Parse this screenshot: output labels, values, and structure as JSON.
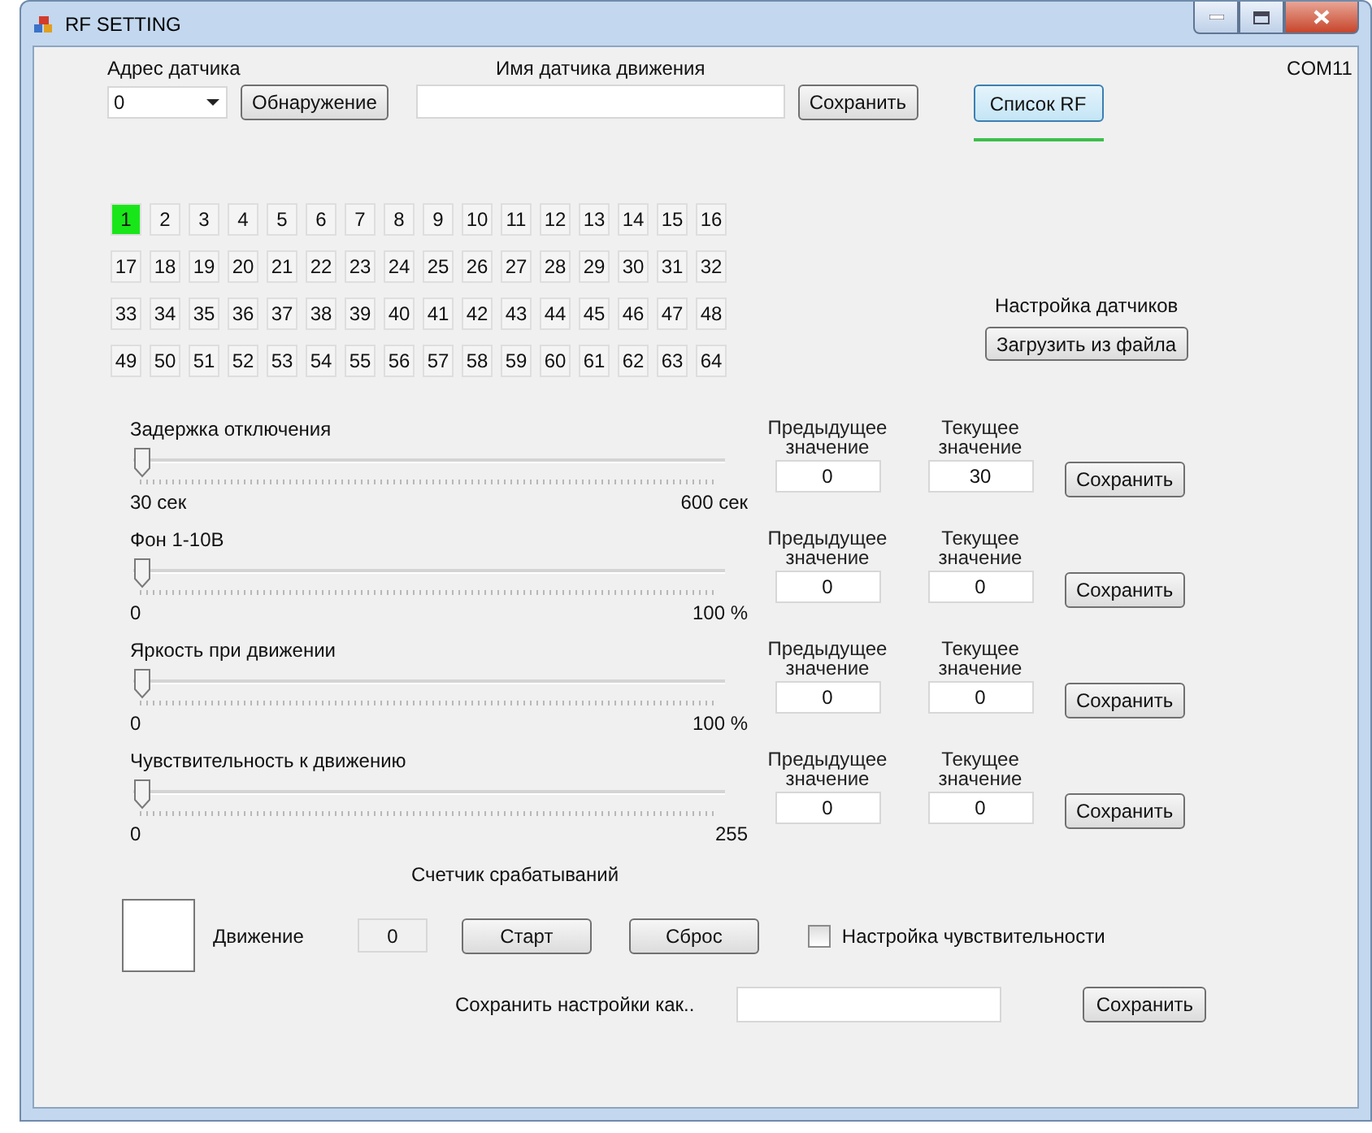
{
  "window": {
    "title": "RF SETTING"
  },
  "address": {
    "label": "Адрес датчика",
    "value": "0"
  },
  "detect_button": "Обнаружение",
  "sensor_name": {
    "label": "Имя датчика движения"
  },
  "save_name_button": "Сохранить",
  "rf_list_button": "Список RF",
  "rf_progress": {
    "level": 1
  },
  "port": "COM11",
  "sensors": [
    {
      "label": "1",
      "selected": true
    },
    {
      "label": "2",
      "selected": false
    },
    {
      "label": "3",
      "selected": false
    },
    {
      "label": "4",
      "selected": false
    },
    {
      "label": "5",
      "selected": false
    },
    {
      "label": "6",
      "selected": false
    },
    {
      "label": "7",
      "selected": false
    },
    {
      "label": "8",
      "selected": false
    },
    {
      "label": "9",
      "selected": false
    },
    {
      "label": "10",
      "selected": false
    },
    {
      "label": "11",
      "selected": false
    },
    {
      "label": "12",
      "selected": false
    },
    {
      "label": "13",
      "selected": false
    },
    {
      "label": "14",
      "selected": false
    },
    {
      "label": "15",
      "selected": false
    },
    {
      "label": "16",
      "selected": false
    },
    {
      "label": "17",
      "selected": false
    },
    {
      "label": "18",
      "selected": false
    },
    {
      "label": "19",
      "selected": false
    },
    {
      "label": "20",
      "selected": false
    },
    {
      "label": "21",
      "selected": false
    },
    {
      "label": "22",
      "selected": false
    },
    {
      "label": "23",
      "selected": false
    },
    {
      "label": "24",
      "selected": false
    },
    {
      "label": "25",
      "selected": false
    },
    {
      "label": "26",
      "selected": false
    },
    {
      "label": "27",
      "selected": false
    },
    {
      "label": "28",
      "selected": false
    },
    {
      "label": "29",
      "selected": false
    },
    {
      "label": "30",
      "selected": false
    },
    {
      "label": "31",
      "selected": false
    },
    {
      "label": "32",
      "selected": false
    },
    {
      "label": "33",
      "selected": false
    },
    {
      "label": "34",
      "selected": false
    },
    {
      "label": "35",
      "selected": false
    },
    {
      "label": "36",
      "selected": false
    },
    {
      "label": "37",
      "selected": false
    },
    {
      "label": "38",
      "selected": false
    },
    {
      "label": "39",
      "selected": false
    },
    {
      "label": "40",
      "selected": false
    },
    {
      "label": "41",
      "selected": false
    },
    {
      "label": "42",
      "selected": false
    },
    {
      "label": "43",
      "selected": false
    },
    {
      "label": "44",
      "selected": false
    },
    {
      "label": "45",
      "selected": false
    },
    {
      "label": "46",
      "selected": false
    },
    {
      "label": "47",
      "selected": false
    },
    {
      "label": "48",
      "selected": false
    },
    {
      "label": "49",
      "selected": false
    },
    {
      "label": "50",
      "selected": false
    },
    {
      "label": "51",
      "selected": false
    },
    {
      "label": "52",
      "selected": false
    },
    {
      "label": "53",
      "selected": false
    },
    {
      "label": "54",
      "selected": false
    },
    {
      "label": "55",
      "selected": false
    },
    {
      "label": "56",
      "selected": false
    },
    {
      "label": "57",
      "selected": false
    },
    {
      "label": "58",
      "selected": false
    },
    {
      "label": "59",
      "selected": false
    },
    {
      "label": "60",
      "selected": false
    },
    {
      "label": "61",
      "selected": false
    },
    {
      "label": "62",
      "selected": false
    },
    {
      "label": "63",
      "selected": false
    },
    {
      "label": "64",
      "selected": false
    }
  ],
  "sensor_settings": {
    "label": "Настройка датчиков",
    "button": "Загрузить из файла"
  },
  "parameters": [
    {
      "label": "Задержка отключения",
      "level": 0,
      "min": "30 сек",
      "max": "600 сек",
      "previous_label": "Предыдущее значение",
      "previous": "0",
      "current_label": "Текущее значение",
      "current": "30",
      "button": "Сохранить"
    },
    {
      "label": "Фон 1-10В",
      "level": 0,
      "min": "0",
      "max": "100 %",
      "previous_label": "Предыдущее значение",
      "previous": "0",
      "current_label": "Текущее значение",
      "current": "0",
      "button": "Сохранить"
    },
    {
      "label": "Яркость при движении",
      "level": 0,
      "min": "0",
      "max": "100 %",
      "previous_label": "Предыдущее значение",
      "previous": "0",
      "current_label": "Текущее значение",
      "current": "0",
      "button": "Сохранить"
    },
    {
      "label": "Чувствительность к движению",
      "level": 0,
      "min": "0",
      "max": "255",
      "previous_label": "Предыдущее значение",
      "previous": "0",
      "current_label": "Текущее значение",
      "current": "0",
      "button": "Сохранить"
    }
  ],
  "counter": {
    "title": "Счетчик срабатываний",
    "motion_active": false,
    "motion_label": "Движение",
    "count": "0",
    "start_button": "Старт",
    "reset_button": "Сброс"
  },
  "sensitivity_setup": {
    "label": "Настройка чувствительности",
    "checked": false
  },
  "save_as": {
    "label": "Сохранить настройки как..",
    "button": "Сохранить"
  }
}
